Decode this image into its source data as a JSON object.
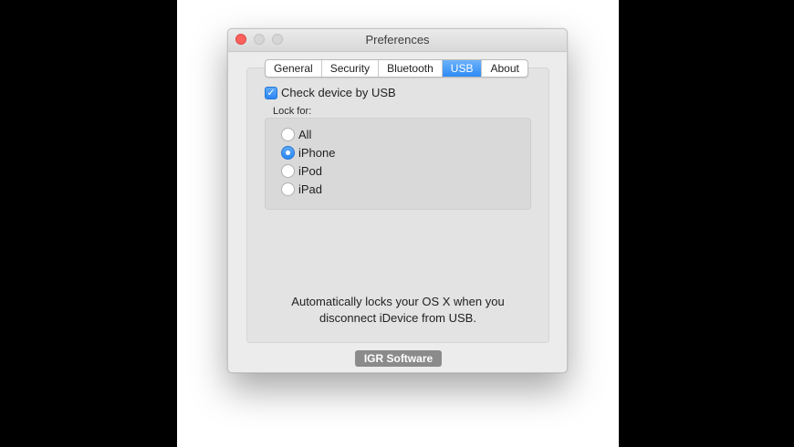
{
  "window": {
    "title": "Preferences"
  },
  "tabs": [
    {
      "label": "General",
      "active": false
    },
    {
      "label": "Security",
      "active": false
    },
    {
      "label": "Bluetooth",
      "active": false
    },
    {
      "label": "USB",
      "active": true
    },
    {
      "label": "About",
      "active": false
    }
  ],
  "usb": {
    "check_label": "Check device by USB",
    "checked": true,
    "lock_for_label": "Lock for:",
    "options": [
      {
        "label": "All",
        "selected": false
      },
      {
        "label": "iPhone",
        "selected": true
      },
      {
        "label": "iPod",
        "selected": false
      },
      {
        "label": "iPad",
        "selected": false
      }
    ],
    "description_line1": "Automatically locks your OS X when you",
    "description_line2": "disconnect iDevice from USB."
  },
  "footer": {
    "brand_label": "IGR Software"
  },
  "colors": {
    "accent": "#2e8af5",
    "close": "#fc605c"
  }
}
